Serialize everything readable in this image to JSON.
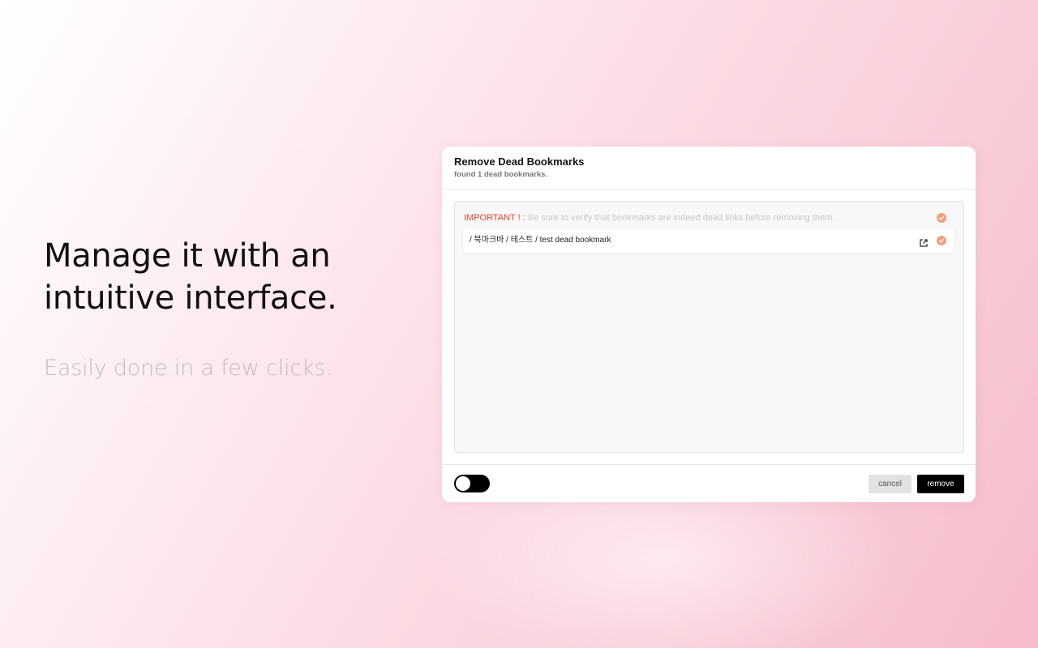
{
  "promo": {
    "headline": "Manage it with an\nintuitive interface.",
    "subline": "Easily done in a few clicks."
  },
  "dialog": {
    "title": "Remove Dead Bookmarks",
    "subtitle": "found 1 dead bookmarks.",
    "notice_label": "IMPORTANT ! :",
    "notice_text": "Be sure to verify that bookmarks are indeed dead links before removing them.",
    "bookmarks": [
      {
        "path": "/ 북마크바 / 테스트 / test dead bookmark",
        "checked": true
      }
    ],
    "cancel_label": "cancel",
    "remove_label": "remove",
    "toggle_on": false
  },
  "colors": {
    "accent_check": "#f4a07a",
    "warning": "#f0402a",
    "primary_button": "#000000"
  },
  "icons": {
    "notice_check": "check-circle-icon",
    "row_open": "external-link-icon",
    "row_check": "check-circle-icon"
  }
}
